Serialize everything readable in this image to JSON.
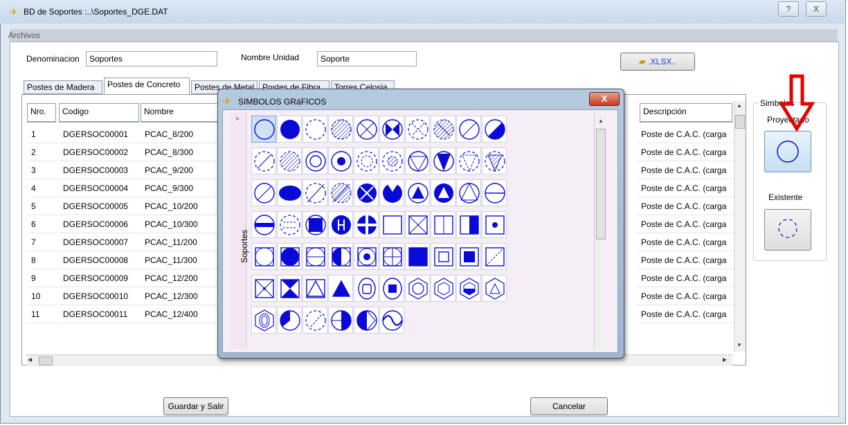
{
  "window": {
    "title": "BD de  Soportes :..\\Soportes_DGE.DAT",
    "help_glyph": "?",
    "close_glyph": "X"
  },
  "menu": {
    "archivos": "Archivos"
  },
  "form": {
    "denominacion_label": "Denominacion",
    "denominacion_value": "Soportes",
    "nombre_unidad_label": "Nombre Unidad",
    "nombre_unidad_value": "Soporte",
    "xlsx_label": ".XLSX.."
  },
  "tabs": [
    "Postes de Madera",
    "Postes de Concreto",
    "Postes de Metal",
    "Postes de Fibra",
    "Torres Celosia"
  ],
  "grid": {
    "columns": [
      "Nro.",
      "Codigo",
      "Nombre",
      "Descripción"
    ],
    "rows": [
      {
        "nro": "1",
        "codigo": "DGERSOC00001",
        "nombre": "PCAC_8/200",
        "descripcion": "Poste de C.A.C. (carga"
      },
      {
        "nro": "2",
        "codigo": "DGERSOC00002",
        "nombre": "PCAC_8/300",
        "descripcion": "Poste de C.A.C. (carga"
      },
      {
        "nro": "3",
        "codigo": "DGERSOC00003",
        "nombre": "PCAC_9/200",
        "descripcion": "Poste de C.A.C. (carga"
      },
      {
        "nro": "4",
        "codigo": "DGERSOC00004",
        "nombre": "PCAC_9/300",
        "descripcion": "Poste de C.A.C. (carga"
      },
      {
        "nro": "5",
        "codigo": "DGERSOC00005",
        "nombre": "PCAC_10/200",
        "descripcion": "Poste de C.A.C. (carga"
      },
      {
        "nro": "6",
        "codigo": "DGERSOC00006",
        "nombre": "PCAC_10/300",
        "descripcion": "Poste de C.A.C. (carga"
      },
      {
        "nro": "7",
        "codigo": "DGERSOC00007",
        "nombre": "PCAC_11/200",
        "descripcion": "Poste de C.A.C. (carga"
      },
      {
        "nro": "8",
        "codigo": "DGERSOC00008",
        "nombre": "PCAC_11/300",
        "descripcion": "Poste de C.A.C. (carga"
      },
      {
        "nro": "9",
        "codigo": "DGERSOC00009",
        "nombre": "PCAC_12/200",
        "descripcion": "Poste de C.A.C. (carga"
      },
      {
        "nro": "10",
        "codigo": "DGERSOC00010",
        "nombre": "PCAC_12/300",
        "descripcion": "Poste de C.A.C. (carga"
      },
      {
        "nro": "11",
        "codigo": "DGERSOC00011",
        "nombre": "PCAC_12/400",
        "descripcion": "Poste de C.A.C. (carga"
      }
    ]
  },
  "simbolos": {
    "group_label": "Simbolos",
    "proyectado_label": "Proyectado",
    "existente_label": "Existente"
  },
  "popup": {
    "title": "SIMBOLOS GRáFICOS",
    "side_label": "Soportes",
    "close_glyph": "X"
  },
  "buttons": {
    "guardar": "Guardar y Salir",
    "cancelar": "Cancelar"
  },
  "colors": {
    "symbol_blue": "#0a0ad8",
    "arrow_red": "#e80000",
    "selected_cell": "#cfe0f7"
  }
}
